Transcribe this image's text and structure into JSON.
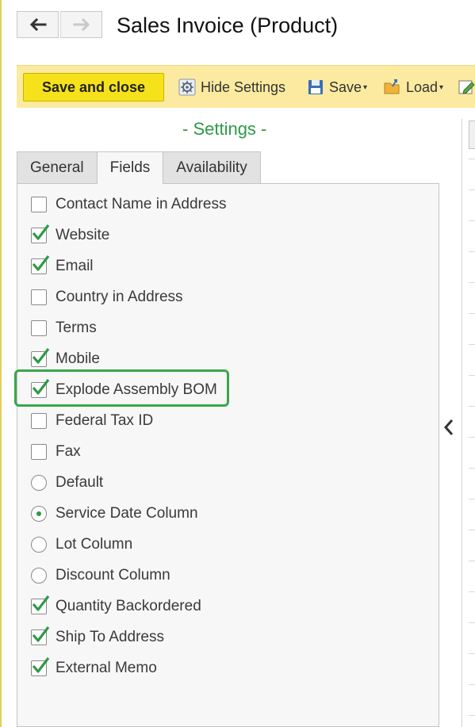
{
  "header": {
    "title": "Sales Invoice (Product)"
  },
  "nav": {
    "back_icon": "arrow-left-icon",
    "forward_icon": "arrow-right-icon"
  },
  "toolbar": {
    "save_close_label": "Save and close",
    "hide_settings_label": "Hide Settings",
    "save_label": "Save",
    "load_label": "Load"
  },
  "settings": {
    "title": "- Settings -",
    "tabs": [
      {
        "label": "General",
        "active": false
      },
      {
        "label": "Fields",
        "active": true
      },
      {
        "label": "Availability",
        "active": false
      }
    ],
    "options": [
      {
        "label": "Contact Name in Address",
        "type": "checkbox",
        "checked": false
      },
      {
        "label": "Website",
        "type": "checkbox",
        "checked": true
      },
      {
        "label": "Email",
        "type": "checkbox",
        "checked": true
      },
      {
        "label": "Country in Address",
        "type": "checkbox",
        "checked": false
      },
      {
        "label": "Terms",
        "type": "checkbox",
        "checked": false
      },
      {
        "label": "Mobile",
        "type": "checkbox",
        "checked": true
      },
      {
        "label": "Explode Assembly BOM",
        "type": "checkbox",
        "checked": true,
        "highlighted": true
      },
      {
        "label": "Federal Tax ID",
        "type": "checkbox",
        "checked": false
      },
      {
        "label": "Fax",
        "type": "checkbox",
        "checked": false
      },
      {
        "label": "Default",
        "type": "radio",
        "checked": false
      },
      {
        "label": "Service Date Column",
        "type": "radio",
        "checked": true
      },
      {
        "label": "Lot Column",
        "type": "radio",
        "checked": false
      },
      {
        "label": "Discount Column",
        "type": "radio",
        "checked": false
      },
      {
        "label": "Quantity Backordered",
        "type": "checkbox",
        "checked": true
      },
      {
        "label": "Ship To Address",
        "type": "checkbox",
        "checked": true
      },
      {
        "label": "External Memo",
        "type": "checkbox",
        "checked": true
      }
    ]
  },
  "colors": {
    "accent_green": "#2e9a46",
    "toolbar_bg": "#fbeaa0",
    "primary_button": "#f6e21a",
    "highlight_border": "#38a84a"
  }
}
